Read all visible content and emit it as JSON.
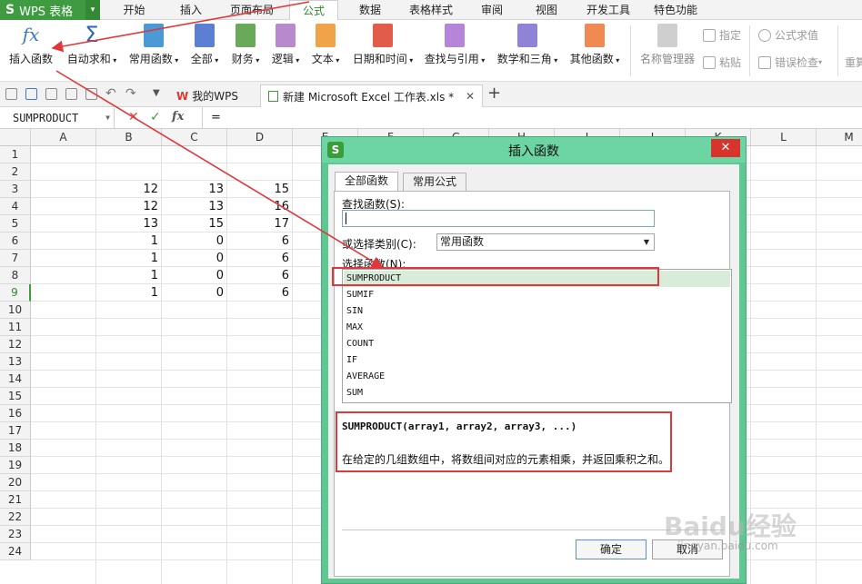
{
  "app": {
    "name": "WPS 表格",
    "logo": "S"
  },
  "ribbon_tabs": [
    "开始",
    "插入",
    "页面布局",
    "公式",
    "数据",
    "表格样式",
    "审阅",
    "视图",
    "开发工具",
    "特色功能"
  ],
  "active_tab": "公式",
  "ribbon": {
    "insert_function": "插入函数",
    "autosum": "自动求和",
    "common": "常用函数",
    "all": "全部",
    "finance": "财务",
    "logic": "逻辑",
    "text": "文本",
    "datetime": "日期和时间",
    "lookup": "查找与引用",
    "math": "数学和三角",
    "other": "其他函数",
    "name_manager": "名称管理器",
    "assign": "指定",
    "paste": "粘贴",
    "formula_eval": "公式求值",
    "error_check": "错误检查",
    "recalc": "重算"
  },
  "doc_tabs": {
    "wps": "我的WPS",
    "file": "新建 Microsoft Excel 工作表.xls *"
  },
  "formula_bar": {
    "name_box": "SUMPRODUCT",
    "fx": "fx",
    "content": "="
  },
  "grid": {
    "columns": [
      "A",
      "B",
      "C",
      "D",
      "E",
      "F",
      "G",
      "H",
      "I",
      "J",
      "K",
      "L",
      "M"
    ],
    "rows": [
      "1",
      "2",
      "3",
      "4",
      "5",
      "6",
      "7",
      "8",
      "9",
      "10",
      "11",
      "12",
      "13",
      "14",
      "15",
      "16",
      "17",
      "18",
      "19",
      "20",
      "21",
      "22",
      "23",
      "24"
    ],
    "selected_row": "9",
    "data": [
      {
        "row": 3,
        "B": "12",
        "C": "13",
        "D": "15"
      },
      {
        "row": 4,
        "B": "12",
        "C": "13",
        "D": "16"
      },
      {
        "row": 5,
        "B": "13",
        "C": "15",
        "D": "17"
      },
      {
        "row": 6,
        "B": "1",
        "C": "0",
        "D": "6"
      },
      {
        "row": 7,
        "B": "1",
        "C": "0",
        "D": "6"
      },
      {
        "row": 8,
        "B": "1",
        "C": "0",
        "D": "6"
      },
      {
        "row": 9,
        "B": "1",
        "C": "0",
        "D": "6"
      }
    ]
  },
  "dialog": {
    "title": "插入函数",
    "close": "✕",
    "tab_all": "全部函数",
    "tab_common": "常用公式",
    "search_label": "查找函数(S):",
    "category_label": "或选择类别(C):",
    "category_value": "常用函数",
    "select_label": "选择函数(N):",
    "functions": [
      "SUMPRODUCT",
      "SUMIF",
      "SIN",
      "MAX",
      "COUNT",
      "IF",
      "AVERAGE",
      "SUM"
    ],
    "selected_function": "SUMPRODUCT",
    "signature": "SUMPRODUCT(array1, array2, array3, ...)",
    "description": "在给定的几组数组中，将数组间对应的元素相乘，并返回乘积之和。",
    "ok": "确定",
    "cancel": "取消"
  },
  "watermark": {
    "logo": "Baidu经验",
    "url": "jingyan.baidu.com"
  },
  "colors": {
    "accent": "#3f9b3f",
    "annotation": "#e0373b",
    "dialog_frame": "#5ec893"
  }
}
